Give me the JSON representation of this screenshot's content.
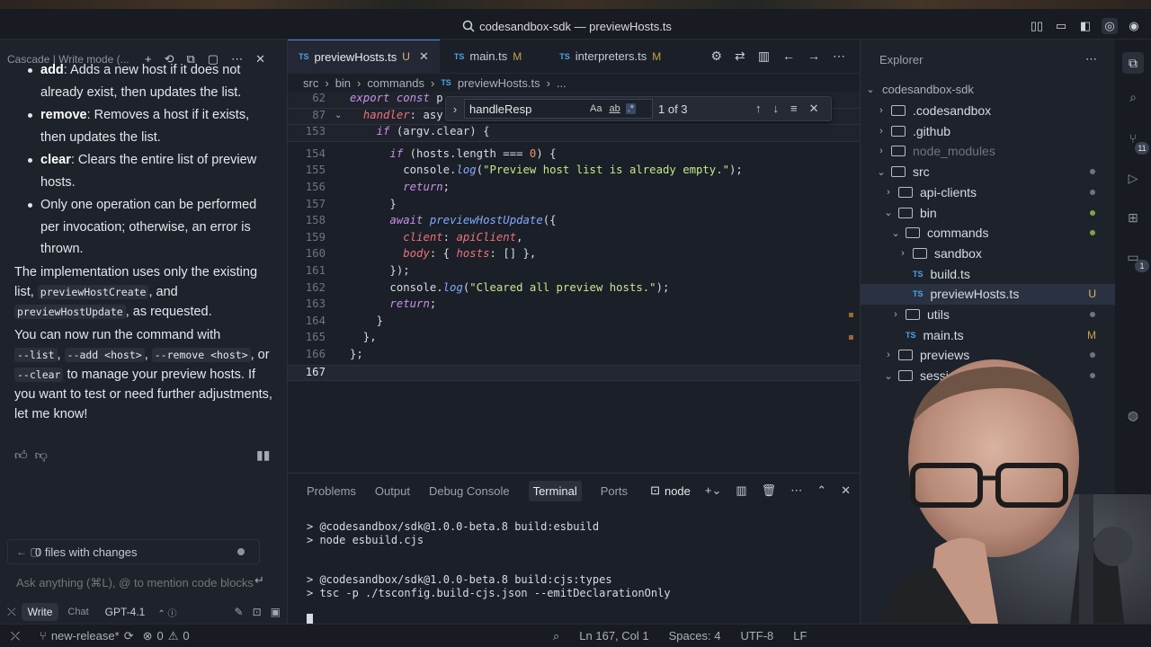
{
  "window": {
    "title": "codesandbox-sdk — previewHosts.ts"
  },
  "cascade": {
    "header": "Cascade | Write mode (...",
    "bullets": [
      {
        "term": "add",
        "text": ": Adds a new host if it does not already exist, then updates the list."
      },
      {
        "term": "remove",
        "text": ": Removes a host if it exists, then updates the list."
      },
      {
        "term": "clear",
        "text": ": Clears the entire list of preview hosts."
      },
      {
        "term": "",
        "text": "Only one operation can be performed per invocation; otherwise, an error is thrown."
      }
    ],
    "para1_a": "The implementation uses only the existing list, ",
    "para1_code1": "previewHostCreate",
    "para1_b": ", and ",
    "para1_code2": "previewHostUpdate",
    "para1_c": ", as requested.",
    "para2_a": "You can now run the command with ",
    "para2_code1": "--list",
    "para2_b": ", ",
    "para2_code2": "--add <host>",
    "para2_c": ", ",
    "para2_code3": "--remove <host>",
    "para2_d": ", or ",
    "para2_code4": "--clear",
    "para2_e": " to manage your preview hosts. If you want to test or need further adjustments, let me know!",
    "files_changes": "0 files with changes",
    "input_placeholder": "Ask anything (⌘L), @ to mention code blocks",
    "mode_write": "Write",
    "mode_chat": "Chat",
    "model": "GPT-4.1"
  },
  "tabs": [
    {
      "label": "previewHosts.ts",
      "status": "U",
      "active": true
    },
    {
      "label": "main.ts",
      "status": "M",
      "active": false
    },
    {
      "label": "interpreters.ts",
      "status": "M",
      "active": false
    }
  ],
  "breadcrumb": [
    "src",
    "bin",
    "commands",
    "previewHosts.ts",
    "..."
  ],
  "find": {
    "query": "handleResp",
    "count": "1 of 3",
    "opt_case": "Aa",
    "opt_word": "ab",
    "opt_regex": ".*"
  },
  "code": {
    "sticky": [
      {
        "n": "62",
        "text": "export const p"
      },
      {
        "n": "87",
        "text": "  handler: asy"
      },
      {
        "n": "153",
        "text": "    if (argv.clear) {"
      }
    ],
    "lines": [
      {
        "n": "154",
        "text": "      if (hosts.length === 0) {"
      },
      {
        "n": "155",
        "text": "        console.log(\"Preview host list is already empty.\");"
      },
      {
        "n": "156",
        "text": "        return;"
      },
      {
        "n": "157",
        "text": "      }"
      },
      {
        "n": "158",
        "text": "      await previewHostUpdate({"
      },
      {
        "n": "159",
        "text": "        client: apiClient,"
      },
      {
        "n": "160",
        "text": "        body: { hosts: [] },"
      },
      {
        "n": "161",
        "text": "      });"
      },
      {
        "n": "162",
        "text": "      console.log(\"Cleared all preview hosts.\");"
      },
      {
        "n": "163",
        "text": "      return;"
      },
      {
        "n": "164",
        "text": "    }"
      },
      {
        "n": "165",
        "text": "  },"
      },
      {
        "n": "166",
        "text": "};"
      },
      {
        "n": "167",
        "text": ""
      }
    ]
  },
  "panel": {
    "tabs": [
      "Problems",
      "Output",
      "Debug Console",
      "Terminal",
      "Ports"
    ],
    "active_tab": "Terminal",
    "shell": "node",
    "terminal": [
      "> @codesandbox/sdk@1.0.0-beta.8 build:esbuild",
      "> node esbuild.cjs",
      "",
      "",
      "> @codesandbox/sdk@1.0.0-beta.8 build:cjs:types",
      "> tsc -p ./tsconfig.build-cjs.json --emitDeclarationOnly"
    ]
  },
  "explorer": {
    "title": "Explorer",
    "root": "codesandbox-sdk",
    "items": [
      {
        "name": ".codesandbox",
        "type": "folder",
        "depth": 1,
        "open": false,
        "status": ""
      },
      {
        "name": ".github",
        "type": "folder",
        "depth": 1,
        "open": false,
        "status": ""
      },
      {
        "name": "node_modules",
        "type": "folder",
        "depth": 1,
        "open": false,
        "status": "",
        "dim": true
      },
      {
        "name": "src",
        "type": "folder",
        "depth": 1,
        "open": true,
        "status": "dot"
      },
      {
        "name": "api-clients",
        "type": "folder",
        "depth": 2,
        "open": false,
        "status": "dot"
      },
      {
        "name": "bin",
        "type": "folder",
        "depth": 2,
        "open": true,
        "status": "dotgreen"
      },
      {
        "name": "commands",
        "type": "folder",
        "depth": 3,
        "open": true,
        "status": "dotgreen"
      },
      {
        "name": "sandbox",
        "type": "folder",
        "depth": 4,
        "open": false,
        "status": ""
      },
      {
        "name": "build.ts",
        "type": "ts",
        "depth": 4,
        "status": ""
      },
      {
        "name": "previewHosts.ts",
        "type": "ts",
        "depth": 4,
        "status": "U",
        "selected": true
      },
      {
        "name": "utils",
        "type": "folder",
        "depth": 3,
        "open": false,
        "status": "dot"
      },
      {
        "name": "main.ts",
        "type": "ts",
        "depth": 3,
        "status": "M"
      },
      {
        "name": "previews",
        "type": "folder",
        "depth": 2,
        "open": false,
        "status": "dot"
      },
      {
        "name": "session",
        "type": "folder",
        "depth": 2,
        "open": true,
        "status": "dot"
      }
    ]
  },
  "activity": {
    "badge1": "11",
    "badge2": "1"
  },
  "statusbar": {
    "branch": "new-release*",
    "errors": "0",
    "warnings": "0",
    "position": "Ln 167, Col 1",
    "spaces": "Spaces: 4",
    "encoding": "UTF-8",
    "eol": "LF"
  },
  "colors": {
    "accent": "#4c8fd6",
    "modified": "#c5a24a",
    "untracked": "#d9b96a"
  }
}
